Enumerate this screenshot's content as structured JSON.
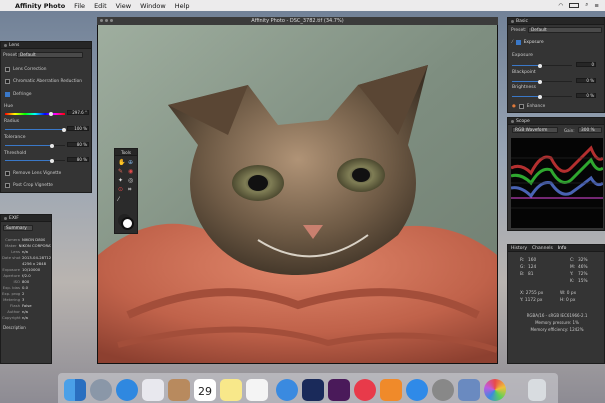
{
  "menubar": {
    "app": "Affinity Photo",
    "items": [
      "File",
      "Edit",
      "View",
      "Window",
      "Help"
    ],
    "clock": "",
    "battery": ""
  },
  "document": {
    "title": "Affinity Photo - DSC_3782.tif (34.7%)"
  },
  "lens": {
    "title": "Lens",
    "preset_label": "Preset:",
    "preset": "Default",
    "lens_correction": "Lens Correction",
    "chromatic": "Chromatic Aberration Reduction",
    "defringe": "Defringe",
    "hue_label": "Hue",
    "hue_value": "297.6 °",
    "radius_label": "Radius",
    "radius_value": "100 %",
    "tolerance_label": "Tolerance",
    "tolerance_value": "80 %",
    "threshold_label": "Threshold",
    "threshold_value": "80 %",
    "remove_vignette": "Remove Lens Vignette",
    "post_crop": "Post Crop Vignette"
  },
  "exif": {
    "title": "EXIF",
    "summary": "Summary",
    "rows": [
      [
        "Camera",
        "NIKON D800"
      ],
      [
        "Maker",
        "NIKON CORPORATION"
      ],
      [
        "Lens",
        "n/a"
      ],
      [
        "Date shot",
        "2013-04-28T12:49:01.25"
      ],
      [
        "",
        "4256 x 2848"
      ],
      [
        "Exposure",
        "10/10000"
      ],
      [
        "Aperture",
        "f/2.0"
      ],
      [
        "ISO",
        "800"
      ],
      [
        "Exp. bias",
        "0.0"
      ],
      [
        "Exp. prog",
        "2"
      ],
      [
        "Metering",
        "3"
      ],
      [
        "Flash",
        "False"
      ],
      [
        "Author",
        "n/a"
      ],
      [
        "Copyright",
        "n/a"
      ]
    ],
    "description_label": "Description"
  },
  "tools": {
    "title": "Tools"
  },
  "basic": {
    "title": "Basic",
    "preset_label": "Preset:",
    "preset": "Default",
    "exposure_hdr": "Exposure",
    "exposure_label": "Exposure",
    "exposure_value": "0",
    "blackpoint_label": "Blackpoint",
    "blackpoint_value": "0 %",
    "brightness_label": "Brightness",
    "brightness_value": "0 %",
    "enhance_hdr": "Enhance"
  },
  "scope": {
    "title": "Scope",
    "mode": "RGB Waveform",
    "gain_label": "Gain:",
    "gain_value": "300 %"
  },
  "info": {
    "tabs": [
      "History",
      "Channels",
      "Info"
    ],
    "r_label": "R:",
    "r": "160",
    "g_label": "G:",
    "g": "124",
    "b_label": "B:",
    "b": "81",
    "c_label": "C:",
    "c": "32%",
    "m_label": "M:",
    "m": "46%",
    "y_label": "Y:",
    "y": "72%",
    "k_label": "K:",
    "k": "15%",
    "x_coord": "X: 2755 px",
    "y_coord": "Y: 1172 px",
    "w_coord": "W: 0 px",
    "h_coord": "H: 0 px",
    "profile": "RGBA/16 - sRGB IEC61966-2.1",
    "memory": "Memory pressure: 1%",
    "efficiency": "Memory efficiency: 1242%"
  },
  "dock": {
    "calendar_day": "29",
    "calendar_month": "APR"
  },
  "colors": {
    "accent": "#3a78c8",
    "panel": "#343434",
    "titlebar": "#262626"
  }
}
